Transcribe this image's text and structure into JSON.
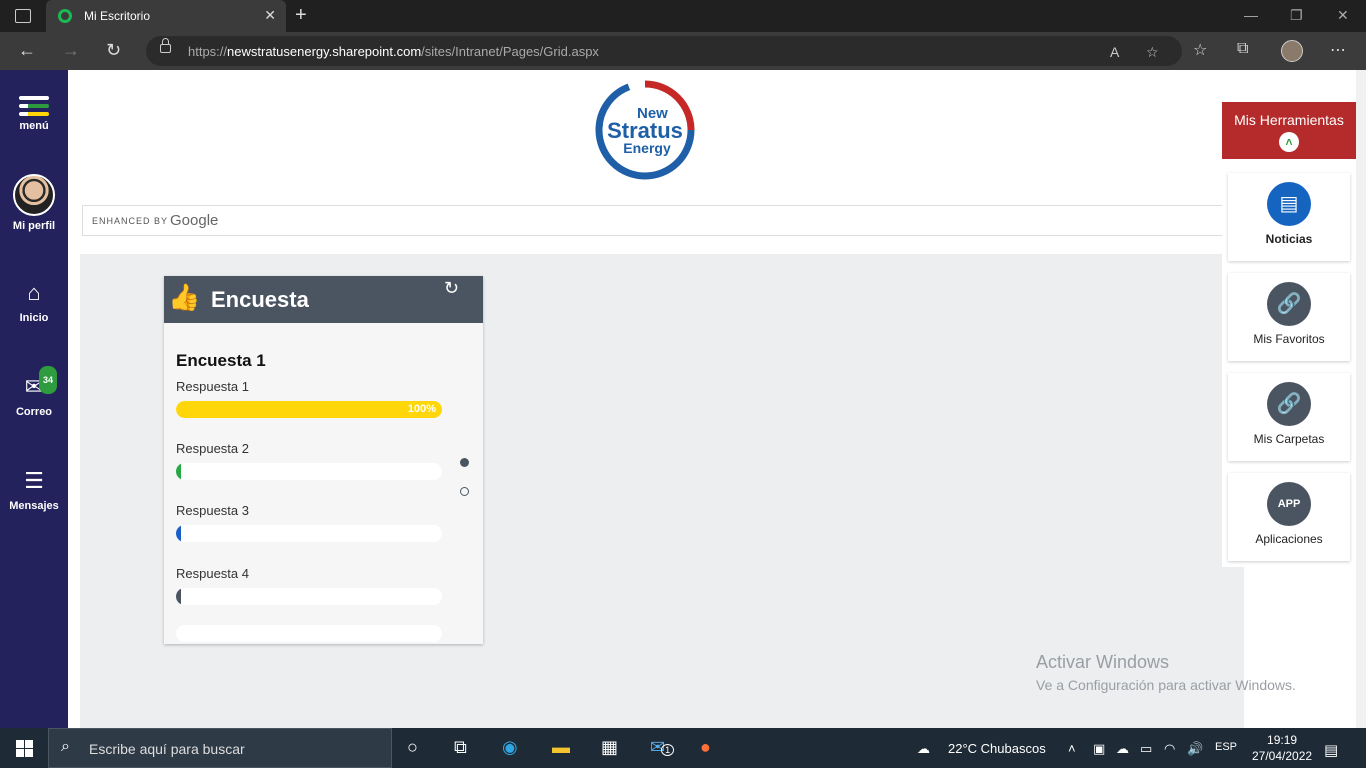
{
  "browser": {
    "tab_title": "Mi Escritorio",
    "url_prefix": "https://",
    "url_domain": "newstratusenergy.sharepoint.com",
    "url_path": "/sites/Intranet/Pages/Grid.aspx"
  },
  "sidebar": {
    "menu_label": "menú",
    "profile_label": "Mi perfil",
    "home_label": "Inicio",
    "mail_label": "Correo",
    "mail_badge": "34",
    "messages_label": "Mensajes"
  },
  "logo": {
    "line1": "New",
    "line2": "Stratus",
    "line3": "Energy"
  },
  "search": {
    "enhanced_by": "ENHANCED BY",
    "google": "Google"
  },
  "survey": {
    "header": "Encuesta",
    "question": "Encuesta 1",
    "answers": [
      {
        "label": "Respuesta 1",
        "percent": 100,
        "pct_text": "100%",
        "color": "#ffd60a"
      },
      {
        "label": "Respuesta 2",
        "percent": 0,
        "pct_text": "",
        "color": "#28a745"
      },
      {
        "label": "Respuesta 3",
        "percent": 0,
        "pct_text": "",
        "color": "#1a5fc8"
      },
      {
        "label": "Respuesta 4",
        "percent": 0,
        "pct_text": "",
        "color": "#4b5562"
      }
    ]
  },
  "tools": {
    "title": "Mis Herramientas",
    "items": [
      {
        "label": "Noticias",
        "color": "#1565c0"
      },
      {
        "label": "Mis Favoritos",
        "color": "#4b5562"
      },
      {
        "label": "Mis Carpetas",
        "color": "#4b5562"
      },
      {
        "label": "Aplicaciones",
        "color": "#4b5562"
      }
    ]
  },
  "watermark": {
    "title": "Activar Windows",
    "subtitle": "Ve a Configuración para activar Windows."
  },
  "taskbar": {
    "search_placeholder": "Escribe aquí para buscar",
    "weather": "22°C  Chubascos",
    "lang": "ESP",
    "time": "19:19",
    "date": "27/04/2022",
    "mail_badge": "1"
  }
}
